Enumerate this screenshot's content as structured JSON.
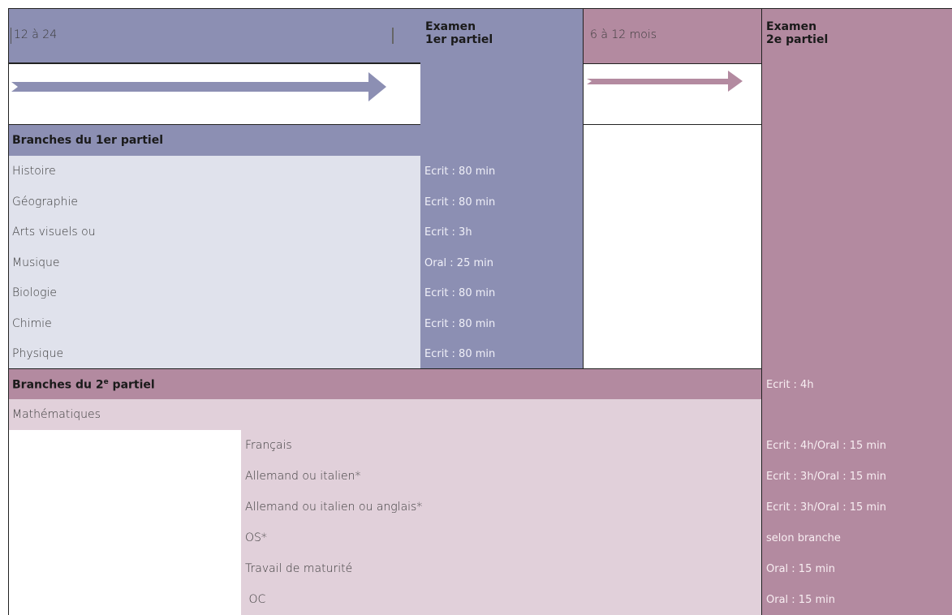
{
  "top_left_label": "12 à 24",
  "exam1_header": [
    "Examen",
    "1er partiel"
  ],
  "mid_label": "6 à 12 mois",
  "exam2_header": [
    "Examen",
    "2e partiel"
  ],
  "section1_title": "Branches du 1er partiel",
  "section1_rows": [
    {
      "subject": "Histoire",
      "exam": "Ecrit : 80 min"
    },
    {
      "subject": "Géographie",
      "exam": "Ecrit : 80 min"
    },
    {
      "subject": "Arts visuels ou",
      "exam": "Ecrit : 3h"
    },
    {
      "subject": "Musique",
      "exam": "Oral : 25 min"
    },
    {
      "subject": "Biologie",
      "exam": "Ecrit : 80 min"
    },
    {
      "subject": "Chimie",
      "exam": "Ecrit : 80 min"
    },
    {
      "subject": "Physique",
      "exam": "Ecrit : 80 min"
    }
  ],
  "section2_title_main": "Branches du 2",
  "section2_title_sup": "e",
  "section2_title_end": " partiel",
  "section2_first_exam": "Ecrit : 4h",
  "section2_math": "Mathématiques",
  "section2_rows": [
    {
      "subject": "Français",
      "exam": "Ecrit : 4h/Oral : 15 min"
    },
    {
      "subject": "Allemand ou italien*",
      "exam": "Ecrit : 3h/Oral : 15 min"
    },
    {
      "subject": "Allemand ou italien ou anglais*",
      "exam": "Ecrit : 3h/Oral : 15 min"
    },
    {
      "subject": "OS*",
      "exam": "selon branche"
    },
    {
      "subject": "Travail de maturité",
      "exam": "Oral : 15 min"
    },
    {
      "subject": " OC",
      "exam": "Oral : 15 min"
    }
  ]
}
